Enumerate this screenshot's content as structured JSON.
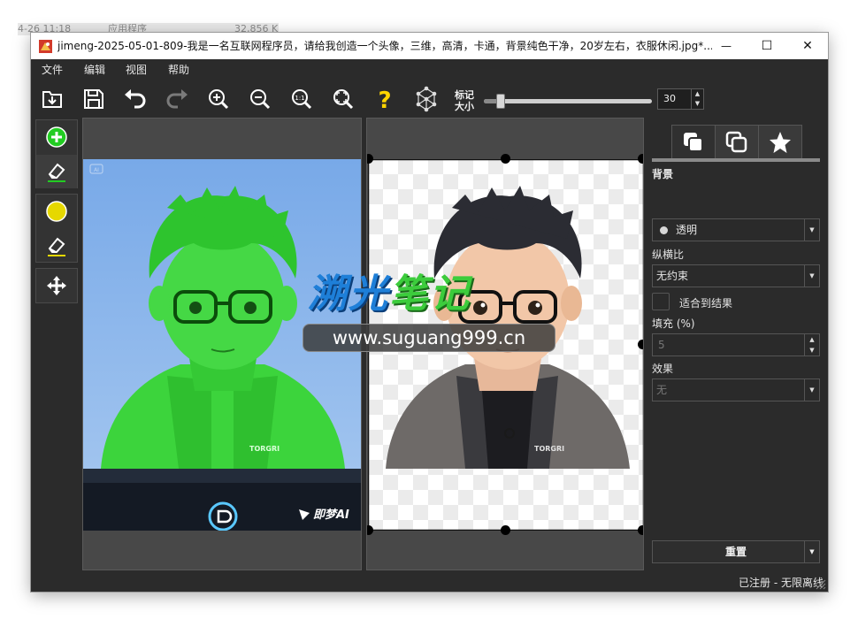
{
  "background_row": {
    "time": "4-26 11:18",
    "type": "应用程序",
    "size": "32,856 KB"
  },
  "window": {
    "title": "jimeng-2025-05-01-809-我是一名互联网程序员，请给我创造一个头像，三维，高清，卡通，背景纯色干净，20岁左右，衣服休闲.jpg*...",
    "controls": {
      "minimize": "—",
      "maximize": "☐",
      "close": "✕"
    }
  },
  "menu": [
    "文件",
    "编辑",
    "视图",
    "帮助"
  ],
  "toolbar": {
    "icons": [
      "open-icon",
      "save-icon",
      "undo-icon",
      "redo-icon",
      "zoom-in-icon",
      "zoom-out-icon",
      "zoom-actual-icon",
      "zoom-fit-icon",
      "help-icon",
      "ai-network-icon"
    ],
    "marker_label_line1": "标记",
    "marker_label_line2": "大小",
    "marker_size": "30",
    "marker_level": 0.1
  },
  "left_tools": [
    "add-foreground-icon",
    "erase-foreground-icon",
    "background-marker-icon",
    "erase-background-icon",
    "move-icon"
  ],
  "source_image": {
    "logo_text": "即梦AI",
    "shirt_text": "TORGRI",
    "badge": "AI"
  },
  "result_image": {
    "shirt_text": "TORGRI"
  },
  "watermark": {
    "title_blue": "溯光",
    "title_green": "笔记",
    "url": "www.suguang999.cn"
  },
  "panel": {
    "tabs": [
      "layers-icon",
      "copy-icon",
      "star-icon"
    ],
    "background_label": "背景",
    "background_value": "透明",
    "aspect_label": "纵横比",
    "aspect_value": "无约束",
    "fit_label": "适合到结果",
    "padding_label": "填充 (%)",
    "padding_value": "5",
    "effect_label": "效果",
    "effect_value": "无",
    "reset_label": "重置"
  },
  "status": "已注册 - 无限离线",
  "colors": {
    "accent_green": "#22cc22",
    "marker_yellow": "#e6d800",
    "watermark_blue": "#1e7fd8",
    "help_yellow": "#ffd400"
  }
}
